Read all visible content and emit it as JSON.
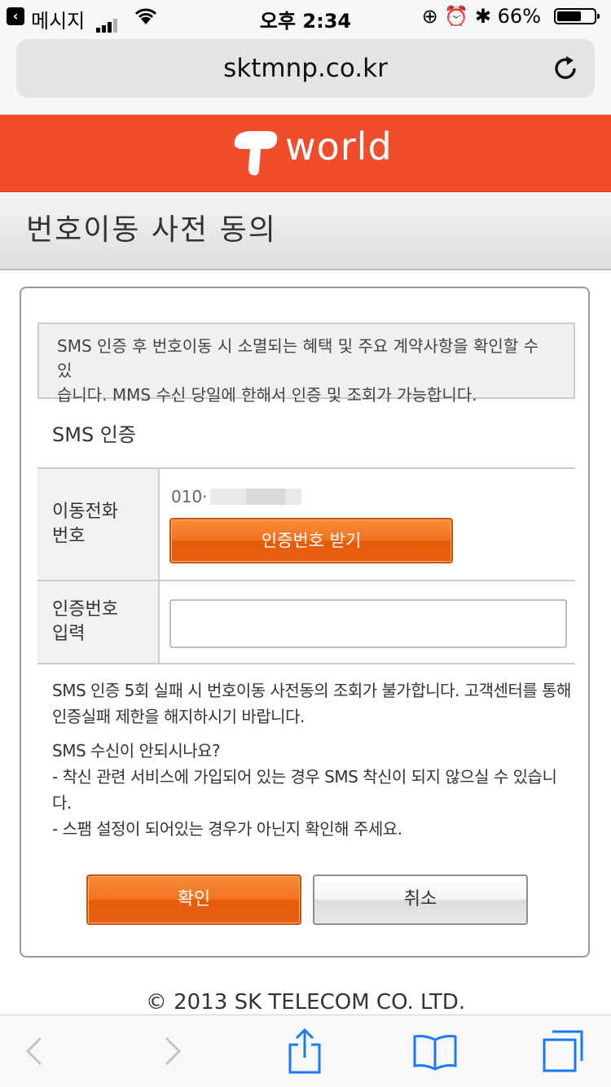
{
  "status_bar": {
    "carrier": "메시지",
    "time": "오후 2:34",
    "battery": "66%",
    "battery_level": 0.66,
    "signal_bars": 3,
    "icons": [
      "back-icon",
      "signal-icon",
      "wifi-icon",
      "rotation-lock-icon",
      "alarm-icon",
      "bluetooth-icon",
      "battery-icon"
    ]
  },
  "browser": {
    "url": "sktmnp.co.kr",
    "reload_icon": "reload-icon",
    "toolbar_icons": [
      "back-arrow-icon",
      "forward-arrow-icon",
      "share-icon",
      "bookmarks-icon",
      "tabs-icon"
    ]
  },
  "brand": {
    "name": "world",
    "logo_icon": "t-logo-icon",
    "color": "#ef4d2b"
  },
  "page": {
    "title": "번호이동 사전 동의",
    "notice_line1": "SMS 인증 후 번호이동 시 소멸되는 혜택 및 주요 계약사항을 확인할 수 있",
    "notice_line2": "습니다. MMS 수신 당일에 한해서 인증 및 조회가 가능합니다.",
    "section_title": "SMS 인증"
  },
  "form": {
    "phone_label_line1": "이동전화",
    "phone_label_line2": "번호",
    "phone_number": "010·",
    "get_code_button": "인증번호 받기",
    "code_label_line1": "인증번호",
    "code_label_line2": "입력",
    "code_value": "",
    "code_placeholder": ""
  },
  "info": {
    "line1": "SMS 인증 5회 실패 시 번호이동 사전동의 조회가 불가합니다. 고객센터를 통해",
    "line2": "인증실패 제한을 해지하시기 바랍니다.",
    "line3": "SMS 수신이 안되시나요?",
    "line4": "- 착신 관련 서비스에 가입되어 있는 경우 SMS 착신이 되지 않으실 수 있습니",
    "line5": "다.",
    "line6": "- 스팸 설정이 되어있는 경우가 아닌지 확인해 주세요."
  },
  "actions": {
    "confirm": "확인",
    "cancel": "취소"
  },
  "footer": {
    "copyright": "© 2013 SK TELECOM CO. LTD."
  }
}
